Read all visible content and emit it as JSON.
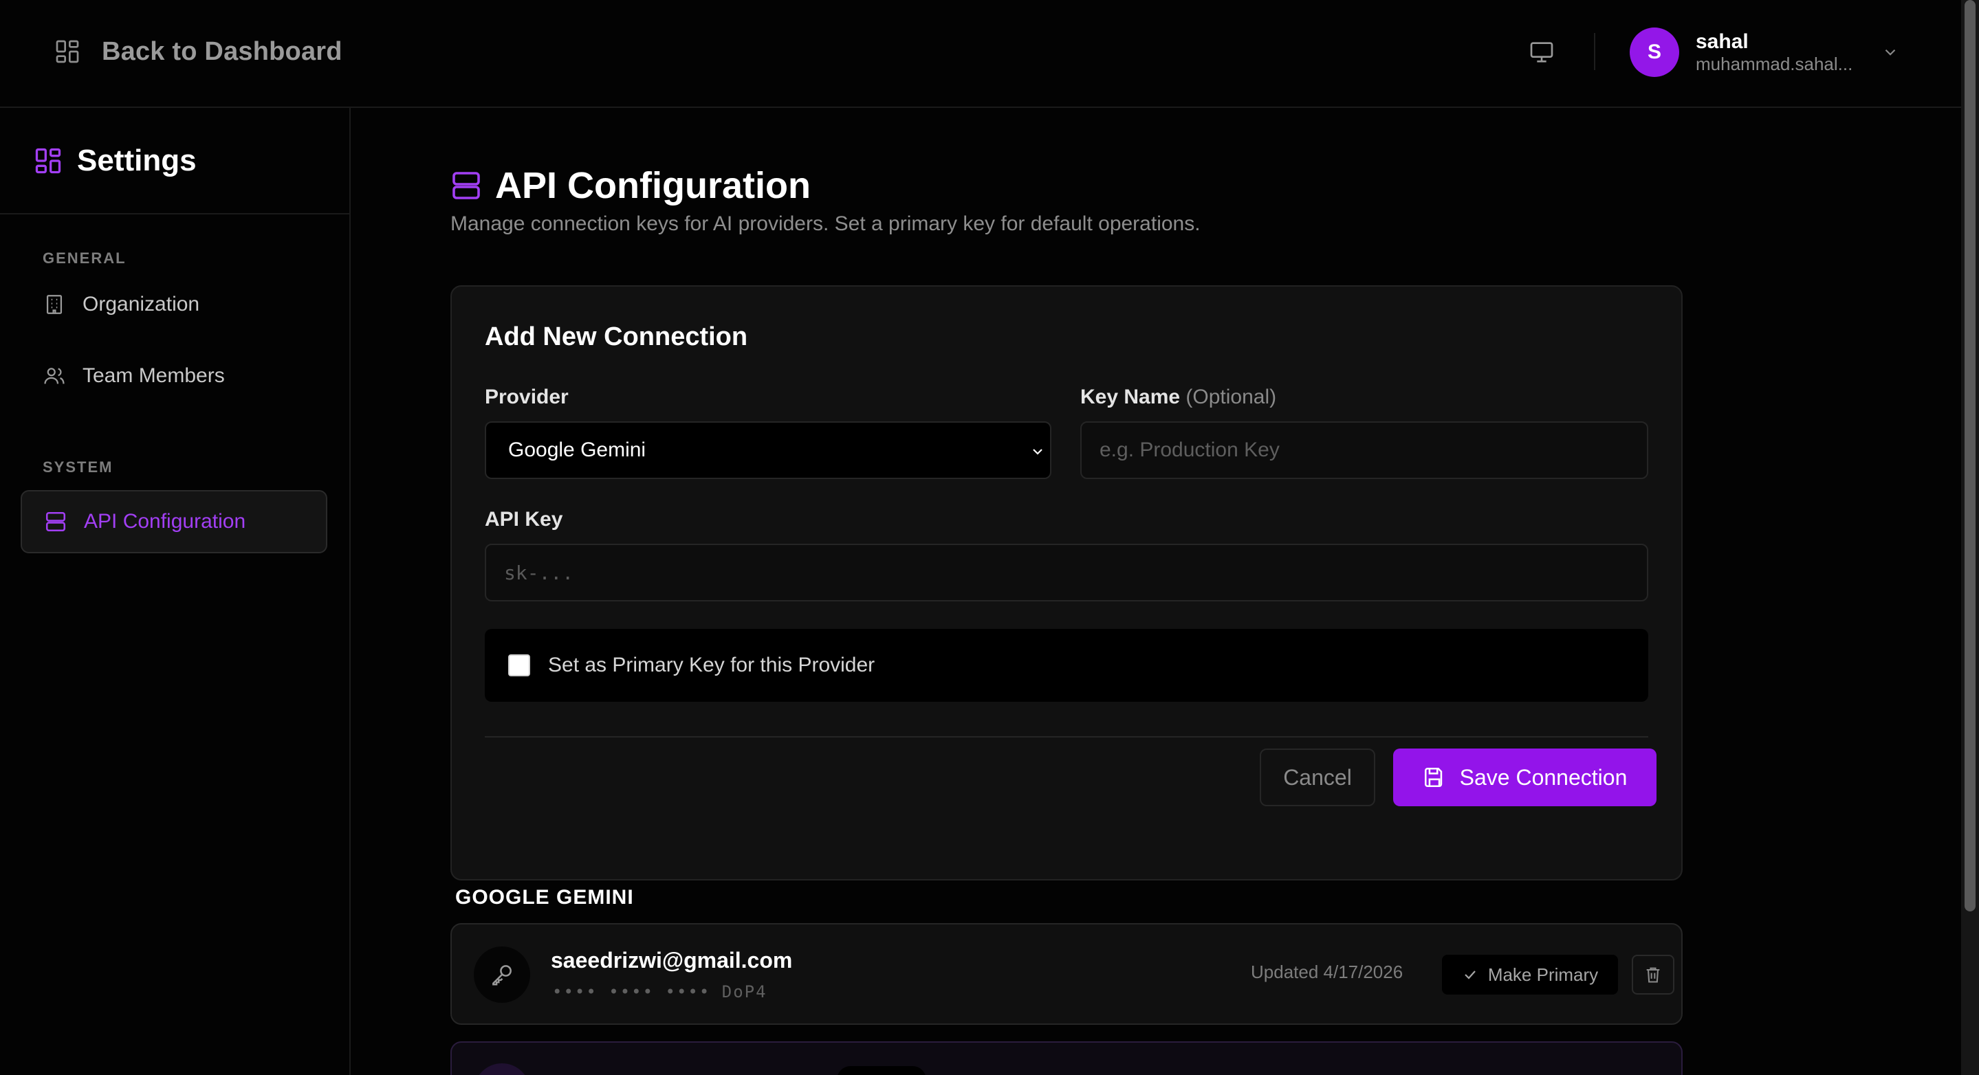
{
  "topbar": {
    "back_label": "Back to Dashboard",
    "user": {
      "initial": "S",
      "name": "sahal",
      "email": "muhammad.sahal..."
    }
  },
  "sidebar": {
    "title": "Settings",
    "sections": [
      {
        "label": "GENERAL",
        "items": [
          {
            "label": "Organization"
          },
          {
            "label": "Team Members"
          }
        ]
      },
      {
        "label": "SYSTEM",
        "items": [
          {
            "label": "API Configuration",
            "active": true
          }
        ]
      }
    ]
  },
  "main": {
    "title": "API Configuration",
    "description": "Manage connection keys for AI providers. Set a primary key for default operations.",
    "form": {
      "title": "Add New Connection",
      "provider_label": "Provider",
      "provider_value": "Google Gemini",
      "key_name_label": "Key Name",
      "key_name_optional": "(Optional)",
      "key_name_placeholder": "e.g. Production Key",
      "api_key_label": "API Key",
      "api_key_placeholder": "sk-...",
      "primary_checkbox_label": "Set as Primary Key for this Provider",
      "primary_checked": false,
      "cancel_label": "Cancel",
      "save_label": "Save Connection"
    },
    "groups": [
      {
        "label": "GOOGLE GEMINI",
        "keys": [
          {
            "name": "saeedrizwi@gmail.com",
            "masked": "•••• •••• •••• DoP4",
            "updated": "Updated 4/17/2026",
            "action_label": "Make Primary"
          }
        ]
      }
    ]
  },
  "colors": {
    "accent": "#9314ea",
    "background": "#030303",
    "card": "#111111"
  }
}
